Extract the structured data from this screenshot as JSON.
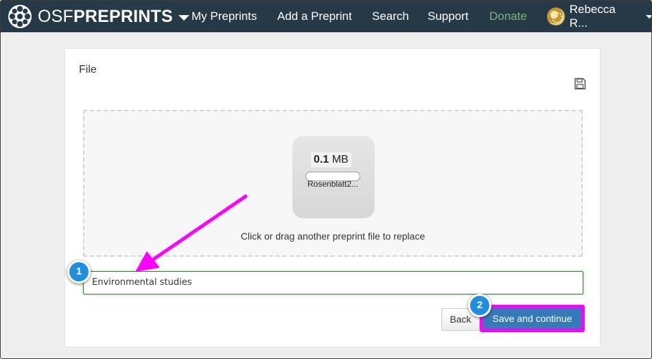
{
  "navbar": {
    "brand_light": "OSF",
    "brand_bold": "PREPRINTS",
    "items": [
      {
        "label": "My Preprints"
      },
      {
        "label": "Add a Preprint"
      },
      {
        "label": "Search"
      },
      {
        "label": "Support"
      },
      {
        "label": "Donate"
      }
    ],
    "user_name": "Rebecca R...",
    "donate_color": "#7fb27a",
    "bg_color": "#263947"
  },
  "panel": {
    "title": "File",
    "save_icon": "floppy-disk-icon",
    "dropzone": {
      "file_size_value": "0.1",
      "file_size_unit": "MB",
      "file_name": "Rosenblatt2...",
      "hint": "Click or drag another preprint file to replace"
    },
    "title_input": {
      "value": "Environmental studies"
    },
    "back_label": "Back",
    "save_label": "Save and continue",
    "primary_color": "#337ab7"
  },
  "annotations": {
    "callout_1": "1",
    "callout_2": "2",
    "highlight_color": "#ff00ff",
    "callout_color": "#1f8ee0"
  }
}
